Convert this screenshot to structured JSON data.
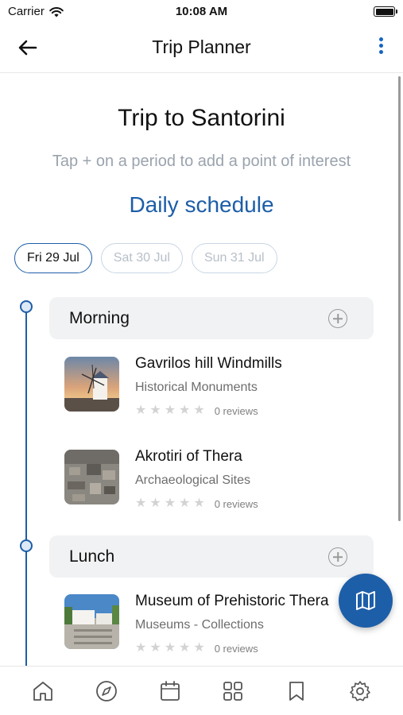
{
  "status_bar": {
    "carrier": "Carrier",
    "time": "10:08 AM"
  },
  "nav": {
    "title": "Trip Planner",
    "back_icon": "arrow-left-icon",
    "more_icon": "more-vertical-icon"
  },
  "trip": {
    "title": "Trip to Santorini",
    "hint": "Tap + on a period to add a point of interest",
    "section_title": "Daily schedule"
  },
  "days": [
    {
      "label": "Fri 29 Jul",
      "selected": true
    },
    {
      "label": "Sat 30 Jul",
      "selected": false
    },
    {
      "label": "Sun 31 Jul",
      "selected": false
    }
  ],
  "periods": [
    {
      "label": "Morning",
      "pois": [
        {
          "name": "Gavrilos hill Windmills",
          "category": "Historical Monuments",
          "rating": 0,
          "reviews": "0 reviews"
        },
        {
          "name": "Akrotiri of Thera",
          "category": "Archaeological Sites",
          "rating": 0,
          "reviews": "0 reviews"
        }
      ]
    },
    {
      "label": "Lunch",
      "pois": [
        {
          "name": "Museum of Prehistoric Thera",
          "category": "Museums - Collections",
          "rating": 0,
          "reviews": "0 reviews"
        }
      ]
    }
  ],
  "fab": {
    "icon": "map-icon"
  },
  "tab_bar": [
    "home-icon",
    "compass-icon",
    "calendar-icon",
    "grid-icon",
    "bookmark-icon",
    "settings-icon"
  ],
  "colors": {
    "accent": "#1d5ea8",
    "chip_border": "#c9d6e4",
    "period_bg": "#f1f2f4",
    "star": "#d3d3d3"
  }
}
